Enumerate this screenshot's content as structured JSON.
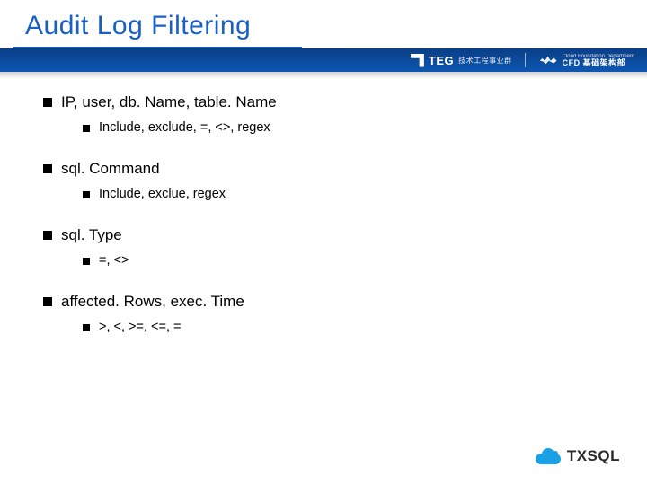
{
  "header": {
    "title": "Audit Log Filtering",
    "logo_teg_text": "TEG",
    "logo_teg_sub": "技术工程事业群",
    "logo_cfd_top": "Cloud Foundation Department",
    "logo_cfd_main": "CFD 基础架构部"
  },
  "bullets": [
    {
      "text": "IP, user, db. Name, table. Name",
      "sub": [
        {
          "text": "Include, exclude, =, <>, regex"
        }
      ]
    },
    {
      "text": "sql. Command",
      "sub": [
        {
          "text": "Include, exclue, regex"
        }
      ]
    },
    {
      "text": "sql. Type",
      "sub": [
        {
          "text": "=, <>"
        }
      ]
    },
    {
      "text": "affected. Rows, exec. Time",
      "sub": [
        {
          "text": ">, <, >=, <=, ="
        }
      ]
    }
  ],
  "footer": {
    "product": "TXSQL"
  }
}
